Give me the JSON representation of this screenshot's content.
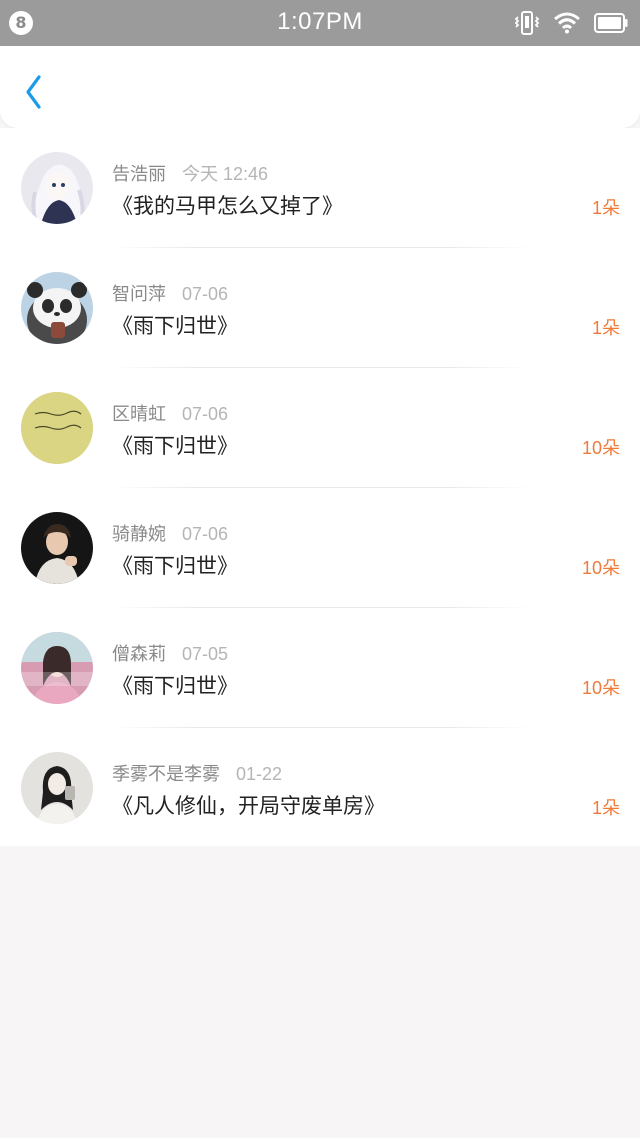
{
  "status_bar": {
    "badge": "8",
    "time": "1:07PM",
    "icons": [
      "vibrate-icon",
      "wifi-icon",
      "battery-icon"
    ]
  },
  "header": {
    "back_icon": "chevron-left-icon"
  },
  "colors": {
    "accent_blue": "#1e9be8",
    "count_orange": "#f07a3a",
    "status_bar_gray": "#9b9b9b"
  },
  "list": [
    {
      "name": "告浩丽",
      "date": "今天 12:46",
      "title": "《我的马甲怎么又掉了》",
      "count": "1朵"
    },
    {
      "name": "智问萍",
      "date": "07-06",
      "title": "《雨下归世》",
      "count": "1朵"
    },
    {
      "name": "区晴虹",
      "date": "07-06",
      "title": "《雨下归世》",
      "count": "10朵"
    },
    {
      "name": "骑静婉",
      "date": "07-06",
      "title": "《雨下归世》",
      "count": "10朵"
    },
    {
      "name": "僧森莉",
      "date": "07-05",
      "title": "《雨下归世》",
      "count": "10朵"
    },
    {
      "name": "季雾不是李雾",
      "date": "01-22",
      "title": "《凡人修仙，开局守废单房》",
      "count": "1朵"
    }
  ]
}
